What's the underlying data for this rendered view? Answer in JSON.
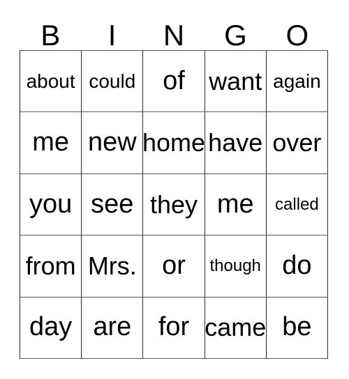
{
  "card": {
    "title": "BINGO",
    "header_letters": [
      "B",
      "I",
      "N",
      "G",
      "O"
    ],
    "columns": 5,
    "rows": 5,
    "colors": {
      "text": "#000000",
      "background": "#ffffff",
      "grid_line": "#2b2b2b"
    },
    "grid": [
      [
        {
          "word": "about"
        },
        {
          "word": "could"
        },
        {
          "word": "of"
        },
        {
          "word": "want"
        },
        {
          "word": "again"
        }
      ],
      [
        {
          "word": "me"
        },
        {
          "word": "new"
        },
        {
          "word": "home"
        },
        {
          "word": "have"
        },
        {
          "word": "over"
        }
      ],
      [
        {
          "word": "you"
        },
        {
          "word": "see"
        },
        {
          "word": "they"
        },
        {
          "word": "me"
        },
        {
          "word": "called"
        }
      ],
      [
        {
          "word": "from"
        },
        {
          "word": "Mrs."
        },
        {
          "word": "or"
        },
        {
          "word": "though"
        },
        {
          "word": "do"
        }
      ],
      [
        {
          "word": "day"
        },
        {
          "word": "are"
        },
        {
          "word": "for"
        },
        {
          "word": "came"
        },
        {
          "word": "be"
        }
      ]
    ]
  }
}
